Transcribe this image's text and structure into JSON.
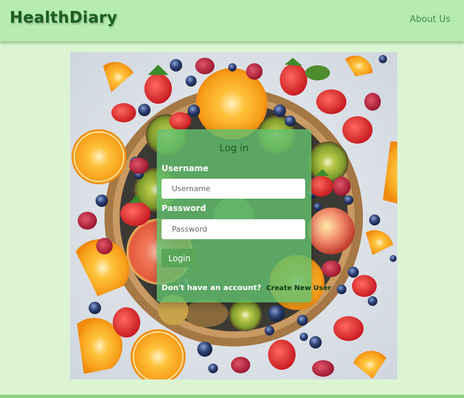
{
  "navbar": {
    "brand": "HealthDiary",
    "about_label": "About Us"
  },
  "login": {
    "title": "Log in",
    "username_label": "Username",
    "username_placeholder": "Username",
    "password_label": "Password",
    "password_placeholder": "Password",
    "button_label": "Login",
    "signup_prompt": "Don't have an account?",
    "signup_link": "Create New User"
  },
  "colors": {
    "page_background": "#dcf4d2",
    "navbar": "#b7ecb0",
    "brand_text": "#1b5e20",
    "card": "#62be6c",
    "button": "#5aa659"
  },
  "hero_image": {
    "subject": "fruit-bowl-photo"
  }
}
